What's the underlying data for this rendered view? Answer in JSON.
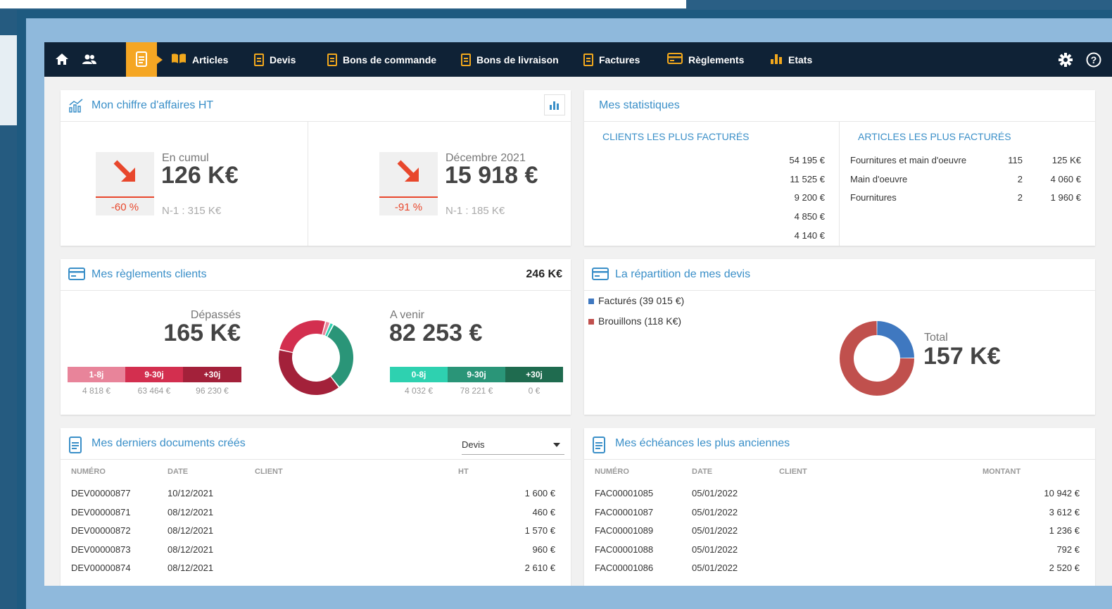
{
  "colors": {
    "nav_bg": "#0f2236",
    "accent": "#f5a623",
    "title_blue": "#3a8fc8",
    "down_red": "#e8472c"
  },
  "nav": {
    "items": [
      {
        "label": "Articles",
        "icon": "book-icon"
      },
      {
        "label": "Devis",
        "icon": "document-icon"
      },
      {
        "label": "Bons de commande",
        "icon": "document-icon"
      },
      {
        "label": "Bons de livraison",
        "icon": "document-icon"
      },
      {
        "label": "Factures",
        "icon": "document-icon"
      },
      {
        "label": "Règlements",
        "icon": "card-icon"
      },
      {
        "label": "Etats",
        "icon": "bar-chart-icon"
      }
    ],
    "left_icons": [
      "home-icon",
      "users-icon",
      "documents-icon"
    ],
    "right_icons": [
      "gear-icon",
      "help-icon"
    ]
  },
  "revenue": {
    "title": "Mon chiffre d'affaires HT",
    "cumul": {
      "label": "En cumul",
      "value": "126 K€",
      "delta": "-60 %",
      "previous": "N-1 : 315 K€"
    },
    "month": {
      "label": "Décembre 2021",
      "value": "15 918 €",
      "delta": "-91 %",
      "previous": "N-1 : 185 K€"
    }
  },
  "stats": {
    "title": "Mes statistiques",
    "clients": {
      "heading": "CLIENTS LES PLUS FACTURÉS",
      "values": [
        "54 195 €",
        "11 525 €",
        "9 200 €",
        "4 850 €",
        "4 140 €"
      ]
    },
    "articles": {
      "heading": "ARTICLES LES PLUS FACTURÉS",
      "rows": [
        {
          "name": "Fournitures et main d'oeuvre",
          "qty": "115",
          "amount": "125 K€"
        },
        {
          "name": "Main d'oeuvre",
          "qty": "2",
          "amount": "4 060 €"
        },
        {
          "name": "Fournitures",
          "qty": "2",
          "amount": "1 960 €"
        }
      ]
    }
  },
  "payments": {
    "title": "Mes règlements clients",
    "total": "246 K€",
    "overdue": {
      "label": "Dépassés",
      "value": "165 K€",
      "buckets": [
        {
          "label": "1-8j",
          "amount": "4 818 €",
          "color": "#e8849a"
        },
        {
          "label": "9-30j",
          "amount": "63 464 €",
          "color": "#d32f4f"
        },
        {
          "label": "+30j",
          "amount": "96 230 €",
          "color": "#a3213a"
        }
      ]
    },
    "upcoming": {
      "label": "A venir",
      "value": "82 253 €",
      "buckets": [
        {
          "label": "0-8j",
          "amount": "4 032 €",
          "color": "#2ed1b0"
        },
        {
          "label": "9-30j",
          "amount": "78 221 €",
          "color": "#2a9578"
        },
        {
          "label": "+30j",
          "amount": "0 €",
          "color": "#1f6b4f"
        }
      ]
    }
  },
  "quotes_split": {
    "title": "La répartition de mes devis",
    "legend": [
      {
        "label": "Facturés (39 015 €)",
        "color": "#3f78c0"
      },
      {
        "label": "Brouillons (118 K€)",
        "color": "#c0504d"
      }
    ],
    "total_label": "Total",
    "total_value": "157 K€"
  },
  "chart_data": [
    {
      "type": "pie",
      "categories": [
        "1-8j",
        "9-30j",
        "+30j",
        "0-8j",
        "9-30j",
        "+30j"
      ],
      "values": [
        4818,
        63464,
        96230,
        4032,
        78221,
        0
      ],
      "title": "",
      "legend": "none"
    },
    {
      "type": "pie",
      "categories": [
        "Facturés",
        "Brouillons"
      ],
      "values": [
        39015,
        118000
      ],
      "title": "",
      "legend": "top-left"
    }
  ],
  "last_docs": {
    "title": "Mes derniers documents créés",
    "filter": "Devis",
    "columns": [
      "NUMÉRO",
      "DATE",
      "CLIENT",
      "HT"
    ],
    "rows": [
      {
        "num": "DEV00000877",
        "date": "10/12/2021",
        "client": "",
        "amount": "1 600 €"
      },
      {
        "num": "DEV00000871",
        "date": "08/12/2021",
        "client": "",
        "amount": "460 €"
      },
      {
        "num": "DEV00000872",
        "date": "08/12/2021",
        "client": "",
        "amount": "1 570 €"
      },
      {
        "num": "DEV00000873",
        "date": "08/12/2021",
        "client": "",
        "amount": "960 €"
      },
      {
        "num": "DEV00000874",
        "date": "08/12/2021",
        "client": "",
        "amount": "2 610 €"
      }
    ]
  },
  "due_dates": {
    "title": "Mes échéances les plus anciennes",
    "columns": [
      "NUMÉRO",
      "DATE",
      "CLIENT",
      "MONTANT"
    ],
    "rows": [
      {
        "num": "FAC00001085",
        "date": "05/01/2022",
        "client": "",
        "amount": "10 942 €"
      },
      {
        "num": "FAC00001087",
        "date": "05/01/2022",
        "client": "",
        "amount": "3 612 €"
      },
      {
        "num": "FAC00001089",
        "date": "05/01/2022",
        "client": "",
        "amount": "1 236 €"
      },
      {
        "num": "FAC00001088",
        "date": "05/01/2022",
        "client": "",
        "amount": "792 €"
      },
      {
        "num": "FAC00001086",
        "date": "05/01/2022",
        "client": "",
        "amount": "2 520 €"
      }
    ]
  }
}
